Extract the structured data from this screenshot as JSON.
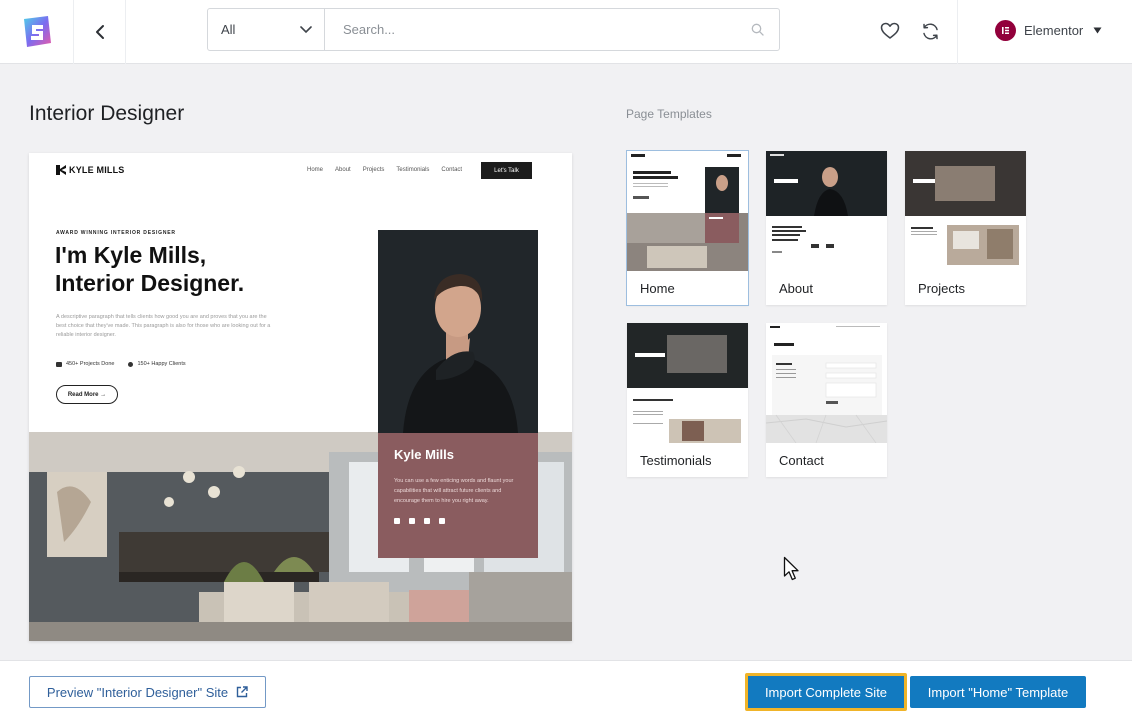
{
  "header": {
    "filter": {
      "selected": "All"
    },
    "search": {
      "placeholder": "Search..."
    },
    "builder": {
      "name": "Elementor"
    }
  },
  "main": {
    "title": "Interior Designer",
    "templates_label": "Page Templates"
  },
  "preview": {
    "brand": "KYLE MILLS",
    "nav": [
      "Home",
      "About",
      "Projects",
      "Testimonials",
      "Contact"
    ],
    "cta": "Let's Talk",
    "eyebrow": "AWARD WINNING INTERIOR DESIGNER",
    "headline_line1": "I'm Kyle Mills,",
    "headline_line2": "Interior Designer.",
    "paragraph": "A descriptive paragraph that tells clients how good you are and proves that you are the best choice that they've made. This paragraph is also for those who are looking out for a reliable interior designer.",
    "stat1": "450+ Projects Done",
    "stat2": "150+ Happy Clients",
    "read_more": "Read More →",
    "card_name": "Kyle Mills",
    "card_text": "You can use a few enticing words and flaunt your capabilities that will attract future clients and encourage them to hire you right away."
  },
  "templates": [
    {
      "label": "Home"
    },
    {
      "label": "About"
    },
    {
      "label": "Projects"
    },
    {
      "label": "Testimonials"
    },
    {
      "label": "Contact"
    }
  ],
  "footer": {
    "preview_button": "Preview \"Interior Designer\" Site",
    "import_site_button": "Import Complete Site",
    "import_home_button": "Import \"Home\" Template"
  },
  "colors": {
    "accent": "#127ac0",
    "highlight": "#f0b429",
    "elementor": "#92003b",
    "card": "#8a5c5f"
  }
}
